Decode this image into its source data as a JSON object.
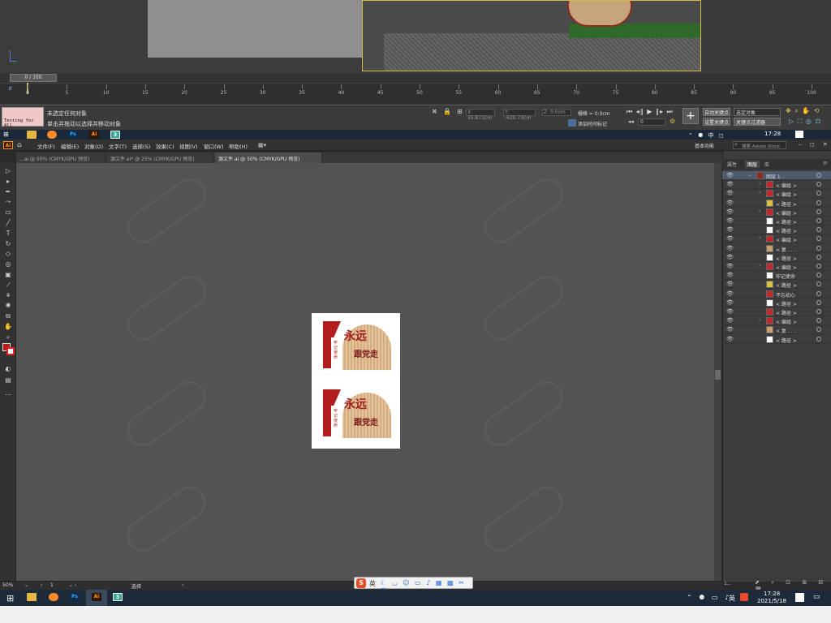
{
  "max": {
    "time_slider_label": "0 / 100",
    "ruler_ticks": [
      "0",
      "5",
      "10",
      "15",
      "20",
      "25",
      "30",
      "35",
      "40",
      "45",
      "50",
      "55",
      "60",
      "65",
      "70",
      "75",
      "80",
      "85",
      "90",
      "95",
      "100"
    ],
    "script_box_label": "Testing for All",
    "status_line1": "未选定任何对象",
    "status_line2": "单击并拖动以选择并移动对象",
    "coord_x": "X: 35.871cm",
    "coord_y": "Y: -620.73cm",
    "coord_z": "Z: 0.0cm",
    "grid": "栅格 = 0.0cm",
    "add_time_tag": "添加时间标记",
    "auto_key": "自动关键点",
    "set_key": "设置关键点",
    "selected_object": "选定对象",
    "key_filters": "关键点过滤器",
    "frame_value": "0"
  },
  "taskbar_top": {
    "time": "17:28",
    "icons": [
      "file-explorer-icon",
      "firefox-icon",
      "photoshop-icon",
      "illustrator-icon",
      "3dsmax-icon"
    ]
  },
  "ai": {
    "logo": "Ai",
    "menus": [
      "文件(F)",
      "编辑(E)",
      "对象(O)",
      "文字(T)",
      "选择(S)",
      "效果(C)",
      "视图(V)",
      "窗口(W)",
      "帮助(H)"
    ],
    "workspace": "基本功能",
    "search_placeholder": "搜索 Adobe Stock",
    "tabs": [
      {
        "label": "...ai @ 50% (CMYK/GPU 预览)",
        "active": false
      },
      {
        "label": "源文件.ai* @ 25% (CMYK/GPU 预览)",
        "active": false
      },
      {
        "label": "源文件.ai @ 50% (CMYK/GPU 预览)",
        "active": true
      }
    ],
    "zoom": "50%",
    "page": "1",
    "status_tool": "选择",
    "artwork": {
      "title": "永远",
      "subtitle": "跟党走",
      "vertical_text": "牢记使命"
    },
    "panel_tabs": [
      "属性",
      "图层",
      "库"
    ],
    "layers": [
      {
        "name": "图层 1",
        "expand": "⌄",
        "top": true
      },
      {
        "name": "< 编组 >",
        "expand": "›"
      },
      {
        "name": "< 编组 >",
        "expand": "›"
      },
      {
        "name": "< 路径 >",
        "expand": ""
      },
      {
        "name": "< 编组 >",
        "expand": "›"
      },
      {
        "name": "< 路径 >",
        "expand": ""
      },
      {
        "name": "< 路径 >",
        "expand": ""
      },
      {
        "name": "< 编组 >",
        "expand": "›"
      },
      {
        "name": "< 复 . . .",
        "expand": ""
      },
      {
        "name": "< 路径 >",
        "expand": ""
      },
      {
        "name": "< 编组 >",
        "expand": "›"
      },
      {
        "name": "牢记使命",
        "expand": ""
      },
      {
        "name": "< 路径 >",
        "expand": ""
      },
      {
        "name": "不忘初心",
        "expand": ""
      },
      {
        "name": "< 路径 >",
        "expand": ""
      },
      {
        "name": "< 路径 >",
        "expand": ""
      },
      {
        "name": "< 编组 >",
        "expand": "›"
      },
      {
        "name": "< 复 . . .",
        "expand": ""
      },
      {
        "name": "< 路径 >",
        "expand": ""
      }
    ],
    "layers_footer": "1..."
  },
  "ime": {
    "logo": "S",
    "mode": "英",
    "icons": "☾ ◡ ☺ ▭ ♪ ▦ ▩ ✂ ⊞"
  },
  "taskbar_bottom": {
    "time": "17:28",
    "date": "2021/5/18",
    "lang": "英"
  },
  "colors": {
    "brand_red": "#b21e1e",
    "ai_orange": "#ff9a00",
    "ps_blue": "#31a8ff",
    "max_teal": "#3ea898"
  }
}
